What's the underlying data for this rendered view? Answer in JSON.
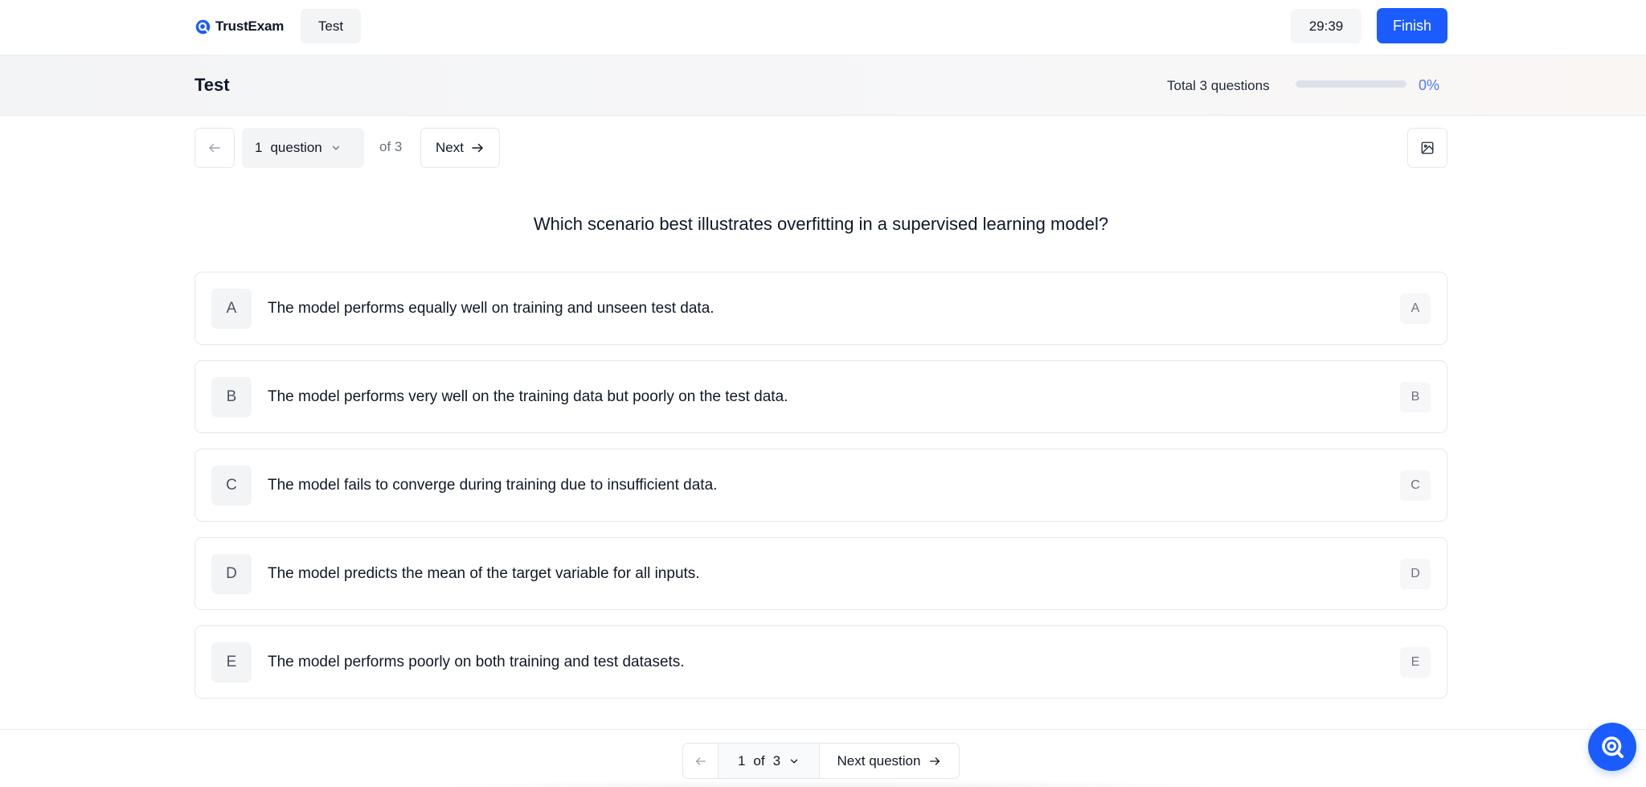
{
  "brand": {
    "name": "TrustExam"
  },
  "topbar": {
    "tab_label": "Test",
    "timer": "29:39",
    "finish_label": "Finish"
  },
  "subheader": {
    "title": "Test",
    "total_questions": "Total 3 questions",
    "progress_percent": "0%",
    "progress_value": 0
  },
  "nav": {
    "current_number": "1",
    "question_word": "question",
    "of_text": "of 3",
    "next_label": "Next"
  },
  "question": {
    "text": "Which scenario best illustrates overfitting in a supervised learning model?"
  },
  "options": [
    {
      "letter": "A",
      "text": "The model performs equally well on training and unseen test data.",
      "key": "A"
    },
    {
      "letter": "B",
      "text": "The model performs very well on the training data but poorly on the test data.",
      "key": "B"
    },
    {
      "letter": "C",
      "text": "The model fails to converge during training due to insufficient data.",
      "key": "C"
    },
    {
      "letter": "D",
      "text": "The model predicts the mean of the target variable for all inputs.",
      "key": "D"
    },
    {
      "letter": "E",
      "text": "The model performs poorly on both training and test datasets.",
      "key": "E"
    }
  ],
  "bottom_nav": {
    "current": "1",
    "of_word": "of",
    "total": "3",
    "next_label": "Next question"
  },
  "icons": {
    "brand": "brand-logo-icon",
    "prev": "arrow-left-icon",
    "next": "arrow-right-icon",
    "dropdown": "chevron-down-icon",
    "image": "image-icon",
    "chat": "chat-bubble-icon"
  },
  "colors": {
    "accent": "#1a5cff",
    "progress_text": "#4f7bf7"
  }
}
